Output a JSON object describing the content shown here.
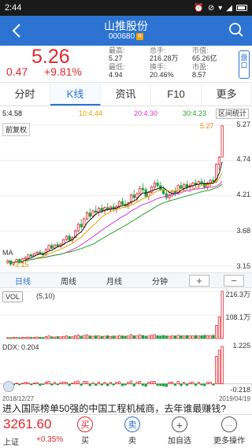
{
  "status": {
    "time": "2:44"
  },
  "header": {
    "stock_name": "山推股份",
    "stock_code": "000680",
    "badge": "R"
  },
  "quote": {
    "price": "5.26",
    "change": "0.47",
    "change_pct": "+9.81%",
    "fields": [
      {
        "label": "最高:",
        "value": "5.27"
      },
      {
        "label": "总手:",
        "value": "216.28万"
      },
      {
        "label": "市值:",
        "value": "65.26亿"
      },
      {
        "label": "最低:",
        "value": "4.94"
      },
      {
        "label": "换手:",
        "value": "20.46%"
      },
      {
        "label": "市盈:",
        "value": "8.57"
      }
    ],
    "side_tab": "盘口"
  },
  "tabs": [
    "分时",
    "K线",
    "资讯",
    "F10",
    "更多"
  ],
  "active_tab": "K线",
  "ma_legend": {
    "ma5": "5:4.58",
    "ma10": "10:4.44",
    "ma20": "20:4.30",
    "ma30": "30:4.23",
    "interval_btn": "区间统计"
  },
  "fq_button": "前复权",
  "price_axis": [
    "5.27",
    "4.74",
    "4.21",
    "3.68",
    "3.15"
  ],
  "markers": {
    "high": "5.27",
    "low": "3.15",
    "ma_label": "MA"
  },
  "periods": [
    "日线",
    "周线",
    "月线",
    "分钟"
  ],
  "zoom": {
    "plus": "+",
    "minus": "−"
  },
  "volume": {
    "label": "VOL",
    "params": "(5,10)",
    "axis": [
      "216.3万",
      "108.1万"
    ]
  },
  "ddx": {
    "label": "DDX: 0.204",
    "axis_top": "1.225",
    "axis_bottom": "-0.218"
  },
  "dates": {
    "start": "2018/12/27",
    "end": "2019/04/19"
  },
  "news": "进入国际榜单50强的中国工程机械商，去年谁最赚钱?",
  "index": {
    "price": "3261.60",
    "name": "上证",
    "change_pct": "+0.35%"
  },
  "bottom_buttons": [
    {
      "icon": "买",
      "label": "买"
    },
    {
      "icon": "卖",
      "label": "卖"
    },
    {
      "icon": "+",
      "label": "加自选"
    },
    {
      "icon": "···",
      "label": "更多操作"
    }
  ],
  "colors": {
    "up": "#e0282f",
    "down": "#1b9e3e",
    "ma5": "#111111",
    "ma10": "#e5a400",
    "ma20": "#d63ad6",
    "ma30": "#2aa02a",
    "primary": "#2c73d2"
  },
  "chart_data": {
    "type": "candlestick",
    "ylim": [
      3.15,
      5.27
    ],
    "candles": [
      [
        3.2,
        3.25,
        3.18,
        3.23
      ],
      [
        3.23,
        3.24,
        3.16,
        3.18
      ],
      [
        3.18,
        3.22,
        3.15,
        3.21
      ],
      [
        3.21,
        3.26,
        3.2,
        3.25
      ],
      [
        3.25,
        3.27,
        3.19,
        3.2
      ],
      [
        3.2,
        3.27,
        3.19,
        3.26
      ],
      [
        3.26,
        3.3,
        3.24,
        3.28
      ],
      [
        3.28,
        3.33,
        3.27,
        3.32
      ],
      [
        3.32,
        3.34,
        3.28,
        3.3
      ],
      [
        3.3,
        3.35,
        3.29,
        3.34
      ],
      [
        3.34,
        3.38,
        3.32,
        3.36
      ],
      [
        3.36,
        3.4,
        3.33,
        3.34
      ],
      [
        3.34,
        3.37,
        3.3,
        3.32
      ],
      [
        3.32,
        3.42,
        3.31,
        3.4
      ],
      [
        3.4,
        3.48,
        3.39,
        3.46
      ],
      [
        3.46,
        3.5,
        3.4,
        3.42
      ],
      [
        3.42,
        3.48,
        3.41,
        3.47
      ],
      [
        3.47,
        3.52,
        3.44,
        3.45
      ],
      [
        3.45,
        3.5,
        3.42,
        3.48
      ],
      [
        3.48,
        3.56,
        3.47,
        3.55
      ],
      [
        3.55,
        3.62,
        3.53,
        3.6
      ],
      [
        3.6,
        3.64,
        3.52,
        3.54
      ],
      [
        3.54,
        3.6,
        3.5,
        3.58
      ],
      [
        3.58,
        3.7,
        3.57,
        3.68
      ],
      [
        3.68,
        3.8,
        3.66,
        3.78
      ],
      [
        3.78,
        3.86,
        3.7,
        3.74
      ],
      [
        3.74,
        3.88,
        3.72,
        3.86
      ],
      [
        3.86,
        3.98,
        3.84,
        3.95
      ],
      [
        3.95,
        4.02,
        3.86,
        3.9
      ],
      [
        3.9,
        4.0,
        3.88,
        3.98
      ],
      [
        3.98,
        4.06,
        3.92,
        3.96
      ],
      [
        3.96,
        4.04,
        3.9,
        4.02
      ],
      [
        4.02,
        4.08,
        3.94,
        3.98
      ],
      [
        3.98,
        4.05,
        3.93,
        4.03
      ],
      [
        4.03,
        4.1,
        3.98,
        4.0
      ],
      [
        4.0,
        4.06,
        3.96,
        4.04
      ],
      [
        4.04,
        4.1,
        3.97,
        4.01
      ],
      [
        4.01,
        4.07,
        3.95,
        4.05
      ],
      [
        4.05,
        4.14,
        4.02,
        4.12
      ],
      [
        4.12,
        4.18,
        4.05,
        4.08
      ],
      [
        4.08,
        4.14,
        4.02,
        4.06
      ],
      [
        4.06,
        4.12,
        4.01,
        4.1
      ],
      [
        4.1,
        4.24,
        4.08,
        4.22
      ],
      [
        4.22,
        4.3,
        4.14,
        4.18
      ],
      [
        4.18,
        4.26,
        4.12,
        4.24
      ],
      [
        4.24,
        4.36,
        4.22,
        4.32
      ],
      [
        4.32,
        4.4,
        4.26,
        4.3
      ],
      [
        4.3,
        4.34,
        4.18,
        4.2
      ],
      [
        4.2,
        4.28,
        4.14,
        4.26
      ],
      [
        4.26,
        4.36,
        4.24,
        4.34
      ],
      [
        4.34,
        4.44,
        4.3,
        4.4
      ],
      [
        4.4,
        4.46,
        4.32,
        4.36
      ],
      [
        4.36,
        4.42,
        4.28,
        4.3
      ],
      [
        4.3,
        4.36,
        4.22,
        4.24
      ],
      [
        4.24,
        4.3,
        4.14,
        4.18
      ],
      [
        4.18,
        4.26,
        4.12,
        4.22
      ],
      [
        4.22,
        4.3,
        4.18,
        4.28
      ],
      [
        4.28,
        4.34,
        4.2,
        4.24
      ],
      [
        4.24,
        4.38,
        4.22,
        4.36
      ],
      [
        4.36,
        4.42,
        4.28,
        4.32
      ],
      [
        4.32,
        4.4,
        4.28,
        4.38
      ],
      [
        4.38,
        4.44,
        4.3,
        4.34
      ],
      [
        4.34,
        4.4,
        4.26,
        4.36
      ],
      [
        4.36,
        4.42,
        4.32,
        4.4
      ],
      [
        4.4,
        4.46,
        4.34,
        4.38
      ],
      [
        4.38,
        4.44,
        4.32,
        4.42
      ],
      [
        4.42,
        4.48,
        4.36,
        4.4
      ],
      [
        4.4,
        4.46,
        4.3,
        4.34
      ],
      [
        4.34,
        4.42,
        4.3,
        4.4
      ],
      [
        4.4,
        4.46,
        4.34,
        4.44
      ],
      [
        4.44,
        4.5,
        4.38,
        4.42
      ],
      [
        4.42,
        4.7,
        4.4,
        4.68
      ],
      [
        4.68,
        4.8,
        4.6,
        4.79
      ],
      [
        4.79,
        5.27,
        4.94,
        5.26
      ]
    ],
    "volumes": [
      5,
      4,
      6,
      5,
      4,
      6,
      5,
      7,
      5,
      6,
      7,
      6,
      5,
      9,
      12,
      8,
      7,
      9,
      8,
      10,
      12,
      9,
      8,
      13,
      16,
      11,
      14,
      17,
      12,
      11,
      13,
      12,
      10,
      11,
      13,
      10,
      12,
      11,
      14,
      12,
      11,
      12,
      18,
      13,
      12,
      17,
      14,
      11,
      12,
      15,
      18,
      13,
      12,
      14,
      12,
      11,
      13,
      12,
      15,
      13,
      12,
      14,
      13,
      12,
      14,
      12,
      13,
      15,
      14,
      13,
      15,
      60,
      100,
      216
    ],
    "ddx": [
      -0.05,
      0.02,
      -0.04,
      0.03,
      -0.03,
      0.02,
      0.05,
      0.04,
      -0.03,
      0.03,
      0.04,
      -0.05,
      -0.02,
      0.06,
      0.08,
      -0.04,
      0.05,
      -0.03,
      0.04,
      0.06,
      0.05,
      -0.06,
      0.03,
      0.07,
      0.09,
      -0.05,
      0.08,
      0.07,
      -0.06,
      0.04,
      -0.05,
      0.06,
      -0.04,
      0.05,
      -0.06,
      0.05,
      -0.04,
      0.05,
      0.07,
      -0.06,
      -0.04,
      0.05,
      0.09,
      -0.07,
      0.06,
      0.08,
      -0.05,
      -0.08,
      0.06,
      0.07,
      0.08,
      -0.05,
      -0.06,
      -0.07,
      -0.09,
      0.05,
      0.06,
      -0.05,
      0.08,
      -0.06,
      0.05,
      -0.05,
      0.04,
      0.06,
      -0.05,
      0.05,
      -0.04,
      -0.06,
      0.05,
      0.06,
      -0.04,
      0.9,
      1.1,
      1.225
    ]
  }
}
